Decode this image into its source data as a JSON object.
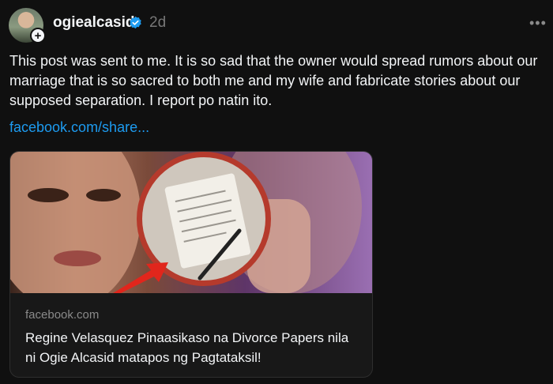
{
  "post": {
    "username": "ogiealcasid",
    "timestamp": "2d",
    "more_icon": "more-horizontal-icon",
    "verified_icon": "verified-badge-icon",
    "follow_icon": "plus-icon",
    "body": "This post was sent to me. It is so sad that the owner would spread rumors about our marriage that is so sacred to both me and my wife and fabricate stories about our supposed separation. I report po natin ito.",
    "link_text": "facebook.com/share..."
  },
  "card": {
    "domain": "facebook.com",
    "title": "Regine Velasquez Pinaasikaso na Divorce Papers nila ni Ogie Alcasid matapos ng Pagtataksil!"
  },
  "colors": {
    "background": "#101010",
    "link": "#1d9bf0",
    "verified": "#1d9bf0",
    "muted": "#777777"
  }
}
